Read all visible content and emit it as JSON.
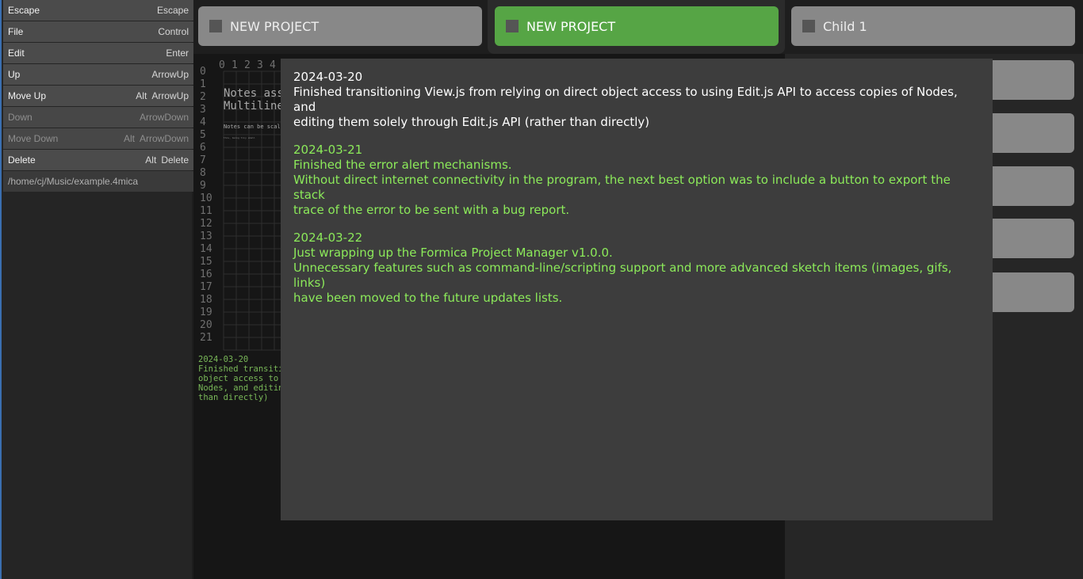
{
  "sidebar": {
    "commands": [
      {
        "label": "Escape",
        "keys": [
          "Escape"
        ],
        "enabled": true
      },
      {
        "label": "File",
        "keys": [
          "Control"
        ],
        "enabled": true
      },
      {
        "label": "Edit",
        "keys": [
          "Enter"
        ],
        "enabled": true
      },
      {
        "label": "Up",
        "keys": [
          "ArrowUp"
        ],
        "enabled": true
      },
      {
        "label": "Move Up",
        "keys": [
          "Alt",
          "ArrowUp"
        ],
        "enabled": true
      },
      {
        "label": "Down",
        "keys": [
          "ArrowDown"
        ],
        "enabled": false
      },
      {
        "label": "Move Down",
        "keys": [
          "Alt",
          "ArrowDown"
        ],
        "enabled": false
      },
      {
        "label": "Delete",
        "keys": [
          "Alt",
          "Delete"
        ],
        "enabled": true
      }
    ],
    "file_path": "/home/cj/Music/example.4mica"
  },
  "tabs": [
    {
      "label": "NEW PROJECT",
      "active": false
    },
    {
      "label": "NEW PROJECT",
      "active": true
    },
    {
      "label": "Child 1",
      "active": false
    }
  ],
  "canvas": {
    "column_numbers": [
      "0",
      "1",
      "2",
      "3",
      "4"
    ],
    "row_numbers": [
      "0",
      "1",
      "2",
      "3",
      "4",
      "5",
      "6",
      "7",
      "8",
      "9",
      "10",
      "11",
      "12",
      "13",
      "14",
      "15",
      "16",
      "17",
      "18",
      "19",
      "20",
      "21"
    ],
    "note_lines": [
      "Notes ass",
      "Multiline"
    ],
    "small_note": "Notes can be scale",
    "tiny_note": "this, being tiny small",
    "log_lines": [
      "2024-03-20",
      "Finished transiti",
      "object access to ",
      "Nodes, and editing",
      "than directly)"
    ]
  },
  "modal": {
    "entries": [
      {
        "date": "2024-03-20",
        "style": "white",
        "lines": [
          "Finished transitioning View.js from relying on direct object access to using Edit.js API to access copies of Nodes, and",
          "editing them solely through Edit.js API (rather than directly)"
        ]
      },
      {
        "date": "2024-03-21",
        "style": "green",
        "lines": [
          "Finished the error alert mechanisms.",
          "Without direct internet connectivity in the program, the next best option was to include a button to export the stack",
          "trace of the error to be sent with a bug report."
        ]
      },
      {
        "date": "2024-03-22",
        "style": "green",
        "lines": [
          "Just wrapping up the Formica Project Manager v1.0.0.",
          "Unnecessary features such as command-line/scripting support and more advanced sketch items (images, gifs, links)",
          "have been moved to the future updates lists."
        ]
      }
    ]
  },
  "colors": {
    "accent_green": "#56a545",
    "log_green": "#8cea5a",
    "sidebar_border": "#3a6fb0"
  }
}
